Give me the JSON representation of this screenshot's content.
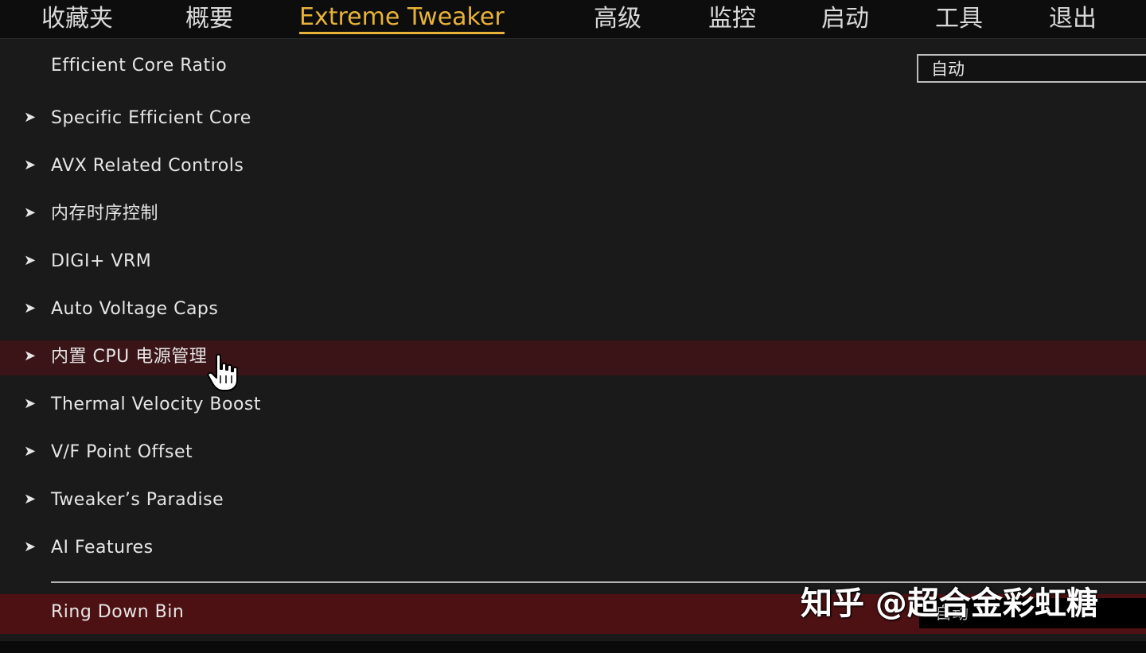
{
  "nav": {
    "tabs": [
      {
        "label": "收藏夹"
      },
      {
        "label": "概要"
      },
      {
        "label": "Extreme Tweaker",
        "active": true
      },
      {
        "label": "高级"
      },
      {
        "label": "监控"
      },
      {
        "label": "启动"
      },
      {
        "label": "工具"
      },
      {
        "label": "退出"
      }
    ]
  },
  "settings": {
    "efficient_core_ratio": {
      "label": "Efficient Core Ratio",
      "value": "自动"
    },
    "submenus": [
      {
        "label": "Specific Efficient Core"
      },
      {
        "label": "AVX Related Controls"
      },
      {
        "label": "内存时序控制"
      },
      {
        "label": "DIGI+ VRM"
      },
      {
        "label": "Auto Voltage Caps"
      },
      {
        "label": "内置 CPU 电源管理"
      },
      {
        "label": "Thermal Velocity Boost"
      },
      {
        "label": "V/F Point Offset"
      },
      {
        "label": "Tweaker’s Paradise"
      },
      {
        "label": "AI Features"
      }
    ],
    "ring_down_bin": {
      "label": "Ring Down Bin",
      "value": "自动"
    }
  },
  "watermark": "知乎 @超合金彩虹糖",
  "colors": {
    "accent": "#e8b23a",
    "hover_row": "#3a1416",
    "selected_row": "#4e1113",
    "background": "#1a1a1a"
  },
  "icons": {
    "submenu_arrow": "arrow-right-icon",
    "cursor": "hand-pointer-icon"
  }
}
